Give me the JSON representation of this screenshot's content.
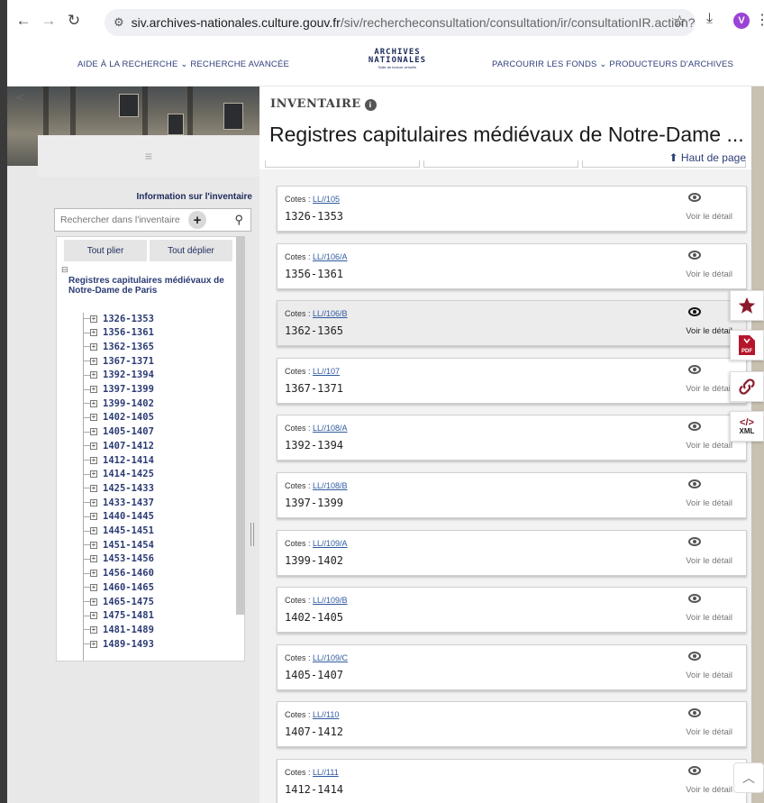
{
  "browser": {
    "url_host": "siv.archives-nationales.culture.gouv.fr",
    "url_path": "/siv/rechercheconsultation/consultation/ir/consultationIR.action?irId...",
    "profile_initial": "V"
  },
  "header": {
    "nav_left": "AIDE À LA RECHERCHE ⌄ RECHERCHE AVANCÉE",
    "logo_line1": "ARCHIVES",
    "logo_line2": "NATIONALES",
    "logo_tagline": "Salle de lecture virtuelle",
    "nav_right": "PARCOURIR LES FONDS ⌄ PRODUCTEURS D'ARCHIVES"
  },
  "sidebar": {
    "info_title": "Information sur l'inventaire",
    "search_placeholder": "Rechercher dans l'inventaire",
    "tout_plier": "Tout plier",
    "tout_deplier": "Tout déplier",
    "root_label": "Registres capitulaires médiévaux de Notre-Dame de Paris",
    "tree": [
      "1326-1353",
      "1356-1361",
      "1362-1365",
      "1367-1371",
      "1392-1394",
      "1397-1399",
      "1399-1402",
      "1402-1405",
      "1405-1407",
      "1407-1412",
      "1412-1414",
      "1414-1425",
      "1425-1433",
      "1433-1437",
      "1440-1445",
      "1445-1451",
      "1451-1454",
      "1453-1456",
      "1456-1460",
      "1460-1465",
      "1465-1475",
      "1475-1481",
      "1481-1489",
      "1489-1493"
    ]
  },
  "main": {
    "inventaire_label": "INVENTAIRE",
    "title": "Registres capitulaires médiévaux de Notre-Dame ...",
    "haut_de_page": "⬆ Haut de page",
    "cotes_label": "Cotes : ",
    "voir_detail": "Voir le détail",
    "cards": [
      {
        "cote": "LL//105",
        "dates": "1326-1353"
      },
      {
        "cote": "LL//106/A",
        "dates": "1356-1361"
      },
      {
        "cote": "LL//106/B",
        "dates": "1362-1365"
      },
      {
        "cote": "LL//107",
        "dates": "1367-1371"
      },
      {
        "cote": "LL//108/A",
        "dates": "1392-1394"
      },
      {
        "cote": "LL//108/B",
        "dates": "1397-1399"
      },
      {
        "cote": "LL//109/A",
        "dates": "1399-1402"
      },
      {
        "cote": "LL//109/B",
        "dates": "1402-1405"
      },
      {
        "cote": "LL//109/C",
        "dates": "1405-1407"
      },
      {
        "cote": "LL//110",
        "dates": "1407-1412"
      },
      {
        "cote": "LL//111",
        "dates": "1412-1414"
      }
    ],
    "highlighted_card": 2
  },
  "tools": {
    "xml_label": "XML",
    "pdf_label": "PDF",
    "accent_color": "#8b1a2b"
  }
}
